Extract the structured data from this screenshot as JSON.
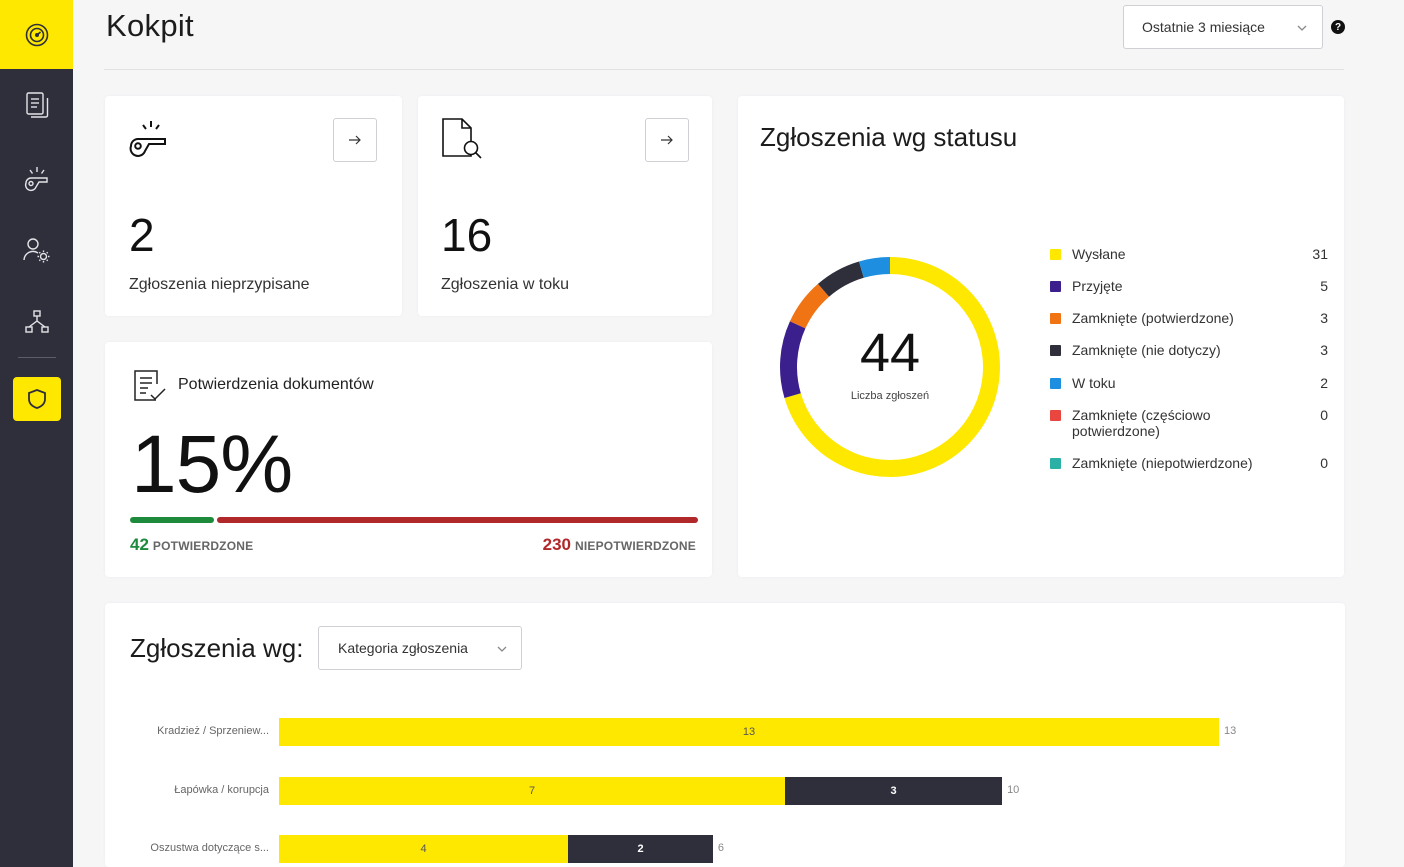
{
  "colors": {
    "accent": "#ffe800",
    "sidebar": "#2e2f3b",
    "confirmed": "#1e8a3c",
    "unconfirmed": "#b1282a"
  },
  "sidebar": {
    "logo_icon": "speedometer-icon",
    "items": [
      {
        "icon": "documents-icon"
      },
      {
        "icon": "whistle-icon"
      },
      {
        "icon": "user-settings-icon"
      },
      {
        "icon": "hierarchy-icon"
      },
      {
        "icon": "shield-icon",
        "active": true
      }
    ]
  },
  "header": {
    "title": "Kokpit",
    "range_value": "Ostatnie 3 miesiące",
    "help": "?"
  },
  "stats": [
    {
      "icon": "whistle-icon",
      "value": "2",
      "label": "Zgłoszenia nieprzypisane"
    },
    {
      "icon": "document-search-icon",
      "value": "16",
      "label": "Zgłoszenia w toku"
    }
  ],
  "documents": {
    "title": "Potwierdzenia dokumentów",
    "percent": "15%",
    "confirmed_count": "42",
    "confirmed_label": "POTWIERDZONE",
    "unconfirmed_count": "230",
    "unconfirmed_label": "NIEPOTWIERDZONE",
    "confirmed_fraction": 0.154
  },
  "status": {
    "title": "Zgłoszenia wg statusu",
    "total": "44",
    "total_label": "Liczba zgłoszeń",
    "items": [
      {
        "label": "Wysłane",
        "count": "31",
        "value": 31,
        "color": "#ffe800"
      },
      {
        "label": "Przyjęte",
        "count": "5",
        "value": 5,
        "color": "#3b1f8c"
      },
      {
        "label": "Zamknięte (potwierdzone)",
        "count": "3",
        "value": 3,
        "color": "#f07314"
      },
      {
        "label": "Zamknięte (nie dotyczy)",
        "count": "3",
        "value": 3,
        "color": "#2e2f3b"
      },
      {
        "label": "W toku",
        "count": "2",
        "value": 2,
        "color": "#1e8fe0"
      },
      {
        "label": "Zamknięte (częściowo potwierdzone)",
        "count": "0",
        "value": 0,
        "color": "#e8463f"
      },
      {
        "label": "Zamknięte (niepotwierdzone)",
        "count": "0",
        "value": 0,
        "color": "#2bb0a6"
      }
    ]
  },
  "by_category": {
    "title": "Zgłoszenia wg:",
    "select_value": "Kategoria zgłoszenia"
  },
  "chart_data": {
    "type": "bar",
    "orientation": "horizontal",
    "stacked": true,
    "categories": [
      "Kradzież / Sprzeniew...",
      "Łapówka / korupcja",
      "Oszustwa dotyczące s..."
    ],
    "series": [
      {
        "values": [
          13,
          7,
          4
        ],
        "color": "#ffe800"
      },
      {
        "values": [
          0,
          3,
          2
        ],
        "color": "#2e2f3b"
      }
    ],
    "totals": [
      13,
      10,
      6
    ],
    "xlim": [
      0,
      13
    ]
  }
}
